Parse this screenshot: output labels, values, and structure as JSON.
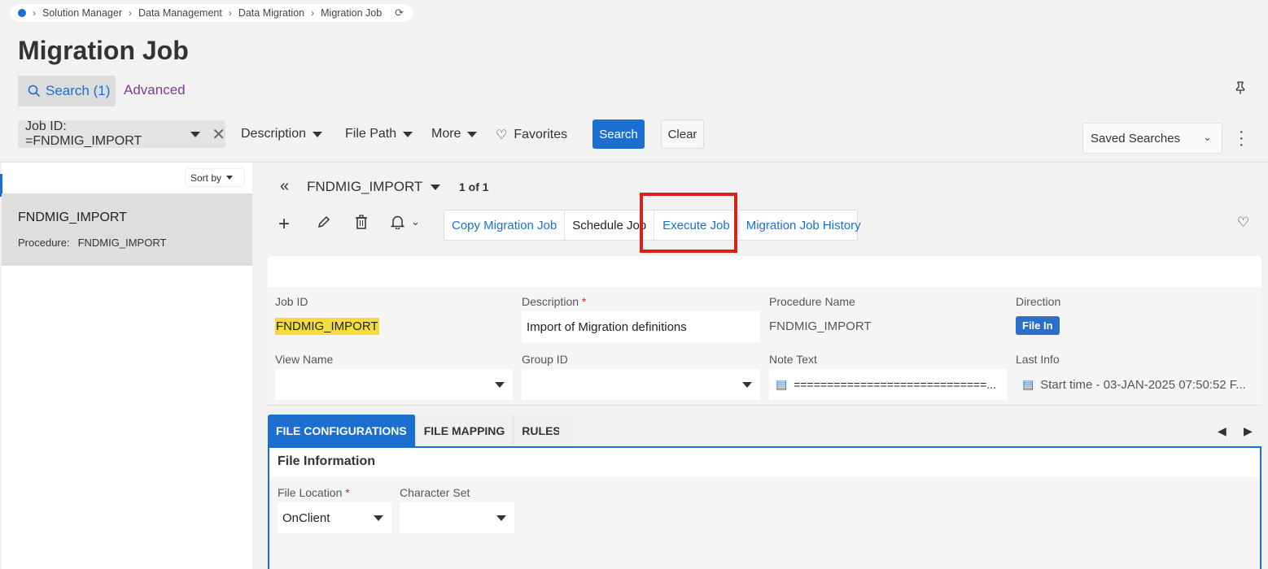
{
  "breadcrumb": {
    "items": [
      "Solution Manager",
      "Data Management",
      "Data Migration",
      "Migration Job"
    ]
  },
  "page": {
    "title": "Migration Job"
  },
  "search": {
    "label": "Search (1)",
    "advanced_label": "Advanced"
  },
  "filters": {
    "active_chip": "Job ID: =FNDMIG_IMPORT",
    "description": "Description",
    "file_path": "File Path",
    "more": "More",
    "favorites": "Favorites",
    "search_button": "Search",
    "clear_button": "Clear",
    "saved_searches": "Saved Searches"
  },
  "list": {
    "sort_label": "Sort by",
    "items": [
      {
        "title": "FNDMIG_IMPORT",
        "sub_label": "Procedure:",
        "sub_value": "FNDMIG_IMPORT"
      }
    ]
  },
  "record": {
    "title": "FNDMIG_IMPORT",
    "count": "1 of 1"
  },
  "commands": {
    "copy": "Copy Migration Job",
    "schedule": "Schedule Job",
    "execute": "Execute Job",
    "history": "Migration Job History"
  },
  "form": {
    "job_id_label": "Job ID",
    "job_id_value": "FNDMIG_IMPORT",
    "description_label": "Description",
    "description_value": "Import of Migration definitions",
    "procedure_label": "Procedure Name",
    "procedure_value": "FNDMIG_IMPORT",
    "direction_label": "Direction",
    "direction_value": "File In",
    "view_name_label": "View Name",
    "view_name_value": "",
    "group_id_label": "Group ID",
    "group_id_value": "",
    "note_text_label": "Note Text",
    "note_text_value": "=============================...",
    "last_info_label": "Last Info",
    "last_info_value": "Start time - 03-JAN-2025 07:50:52  F..."
  },
  "tabs": [
    "FILE CONFIGURATIONS",
    "FILE MAPPING",
    "RULES"
  ],
  "file_info": {
    "title": "File Information",
    "location_label": "File Location",
    "location_value": "OnClient",
    "charset_label": "Character Set",
    "charset_value": ""
  },
  "colors": {
    "accent": "#1b6fd1",
    "highlight_box": "#d9221c",
    "match_highlight": "#f5dc3e"
  }
}
